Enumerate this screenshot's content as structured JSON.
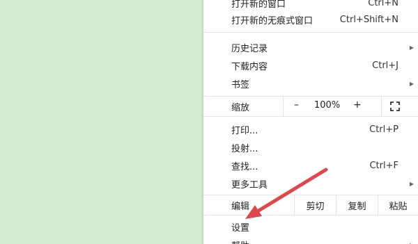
{
  "menu": {
    "new_window": {
      "label": "打开新的窗口",
      "shortcut": "Ctrl+N"
    },
    "new_incognito": {
      "label": "打开新的无痕式窗口",
      "shortcut": "Ctrl+Shift+N"
    },
    "history": {
      "label": "历史记录"
    },
    "downloads": {
      "label": "下载内容",
      "shortcut": "Ctrl+J"
    },
    "bookmarks": {
      "label": "书签"
    },
    "zoom": {
      "label": "缩放",
      "minus": "–",
      "value": "100%",
      "plus": "+"
    },
    "print": {
      "label": "打印...",
      "shortcut": "Ctrl+P"
    },
    "cast": {
      "label": "投射..."
    },
    "find": {
      "label": "查找...",
      "shortcut": "Ctrl+F"
    },
    "more_tools": {
      "label": "更多工具"
    },
    "edit": {
      "label": "编辑",
      "cut": "剪切",
      "copy": "复制",
      "paste": "粘贴"
    },
    "settings": {
      "label": "设置"
    },
    "help": {
      "label": "帮助"
    }
  },
  "annotation": {
    "arrow_color": "#e0474c"
  }
}
